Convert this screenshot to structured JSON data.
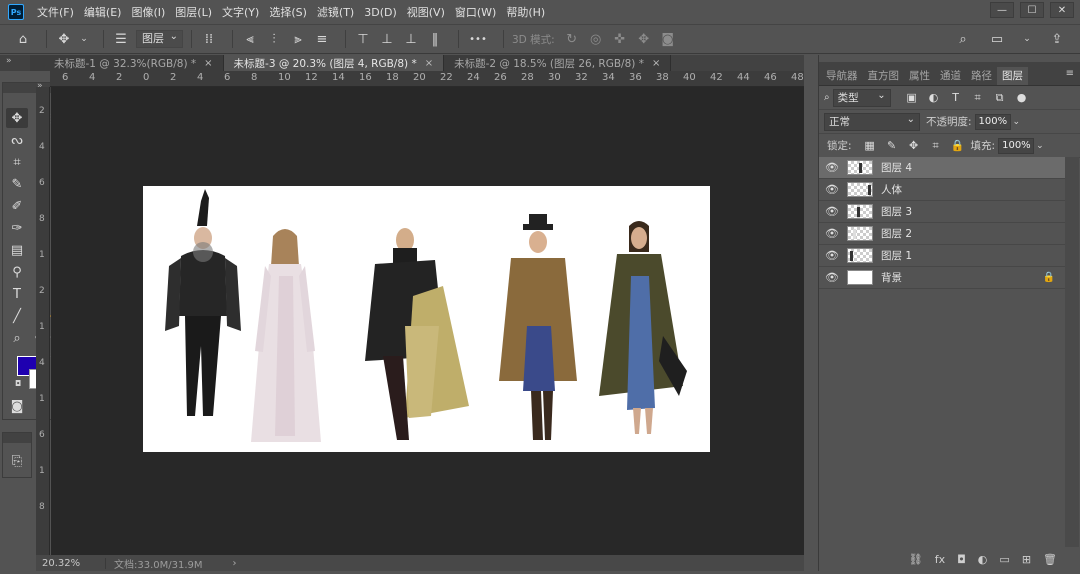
{
  "app": {
    "logo": "Ps"
  },
  "menu": [
    "文件(F)",
    "编辑(E)",
    "图像(I)",
    "图层(L)",
    "文字(Y)",
    "选择(S)",
    "滤镜(T)",
    "3D(D)",
    "视图(V)",
    "窗口(W)",
    "帮助(H)"
  ],
  "options": {
    "layer_select": "图层",
    "mode_3d": "3D 模式:",
    "more": "•••"
  },
  "tabs": [
    {
      "label": "未标题-1 @ 32.3%(RGB/8) *",
      "close": "×"
    },
    {
      "label": "未标题-3 @ 20.3% (图层 4, RGB/8) *",
      "close": "×"
    },
    {
      "label": "未标题-2 @ 18.5% (图层 26, RGB/8) *",
      "close": "×"
    }
  ],
  "ruler_top": [
    "6",
    "4",
    "2",
    "0",
    "2",
    "4",
    "6",
    "8",
    "10",
    "12",
    "14",
    "16",
    "18",
    "20",
    "22",
    "24",
    "26",
    "28",
    "30",
    "32",
    "34",
    "36",
    "38",
    "40",
    "42",
    "44",
    "46",
    "48"
  ],
  "ruler_left": [
    "2",
    "4",
    "6",
    "8",
    "1",
    "2",
    "1",
    "4",
    "1",
    "6",
    "1",
    "8"
  ],
  "status": {
    "zoom": "20.32%",
    "doc": "文档:33.0M/31.9M",
    "arrow": "›"
  },
  "panel": {
    "tabs": [
      "导航器",
      "直方图",
      "属性",
      "通道",
      "路径",
      "图层"
    ],
    "filter_type": "类型",
    "blend_mode": "正常",
    "opacity_label": "不透明度:",
    "opacity": "100%",
    "lock_label": "锁定:",
    "fill_label": "填充:",
    "fill": "100%"
  },
  "layers": [
    {
      "name": "图层 4",
      "selected": true
    },
    {
      "name": "人体",
      "selected": false
    },
    {
      "name": "图层 3",
      "selected": false
    },
    {
      "name": "图层 2",
      "selected": false
    },
    {
      "name": "图层 1",
      "selected": false
    },
    {
      "name": "背景",
      "selected": false,
      "locked": true
    }
  ],
  "colors": {
    "foreground": "#1e00b0",
    "background": "#ffffff"
  }
}
